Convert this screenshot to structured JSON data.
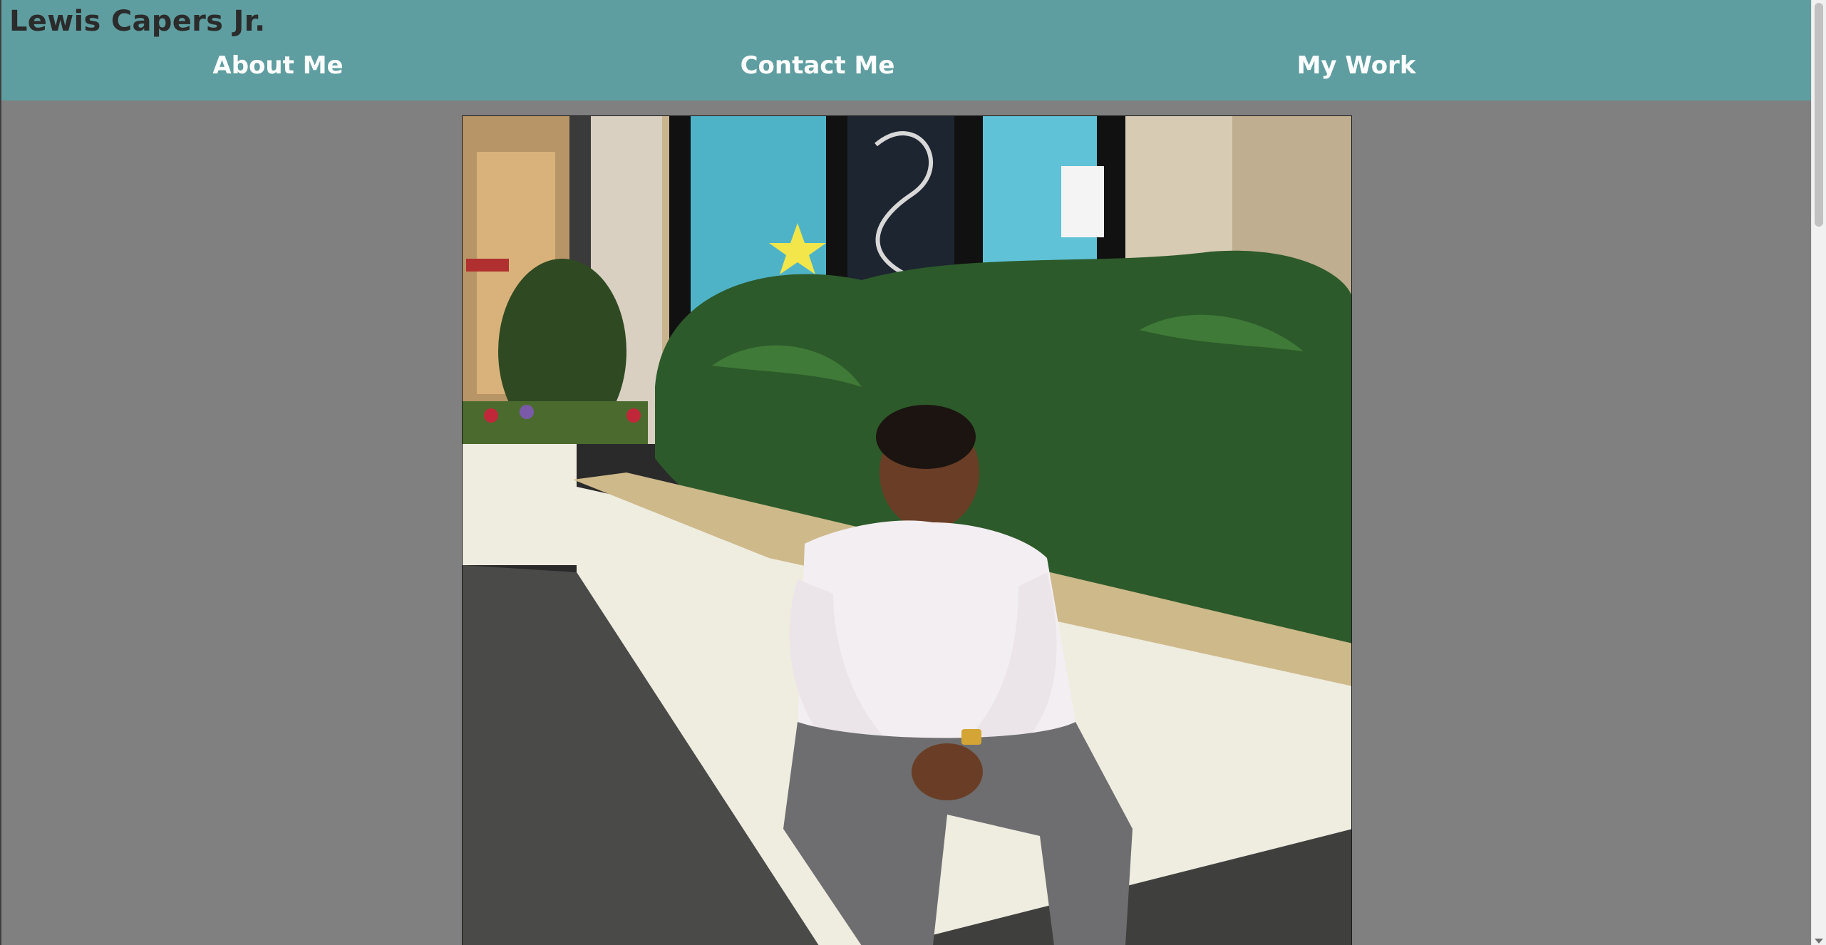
{
  "header": {
    "title": "Lewis Capers Jr.",
    "background_color": "#5f9ea0"
  },
  "nav": {
    "items": [
      {
        "label": "About Me"
      },
      {
        "label": "Contact Me"
      },
      {
        "label": "My Work"
      }
    ]
  },
  "main": {
    "photo": {
      "subject": "portrait-photo"
    }
  },
  "colors": {
    "page_background": "#808080",
    "nav_text": "#ffffff",
    "title_text": "#2b2b2b"
  }
}
